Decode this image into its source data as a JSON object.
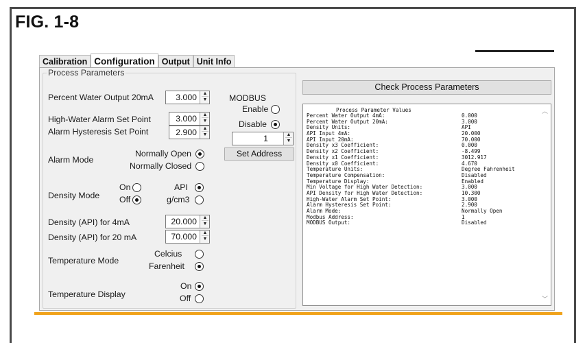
{
  "figure_title": "FIG. 1-8",
  "tabs": [
    "Calibration",
    "Configuration",
    "Output",
    "Unit Info"
  ],
  "process_parameters_title": "Process Parameters",
  "fields": {
    "percent_water_20ma": {
      "label": "Percent Water Output 20mA",
      "value": "3.000"
    },
    "high_water_alarm": {
      "label": "High-Water Alarm Set Point",
      "value": "3.000"
    },
    "alarm_hysteresis": {
      "label": "Alarm Hysteresis Set Point",
      "value": "2.900"
    },
    "density_4ma": {
      "label": "Density (API) for 4mA",
      "value": "20.000"
    },
    "density_20ma": {
      "label": "Density (API) for 20 mA",
      "value": "70.000"
    }
  },
  "alarm_mode": {
    "label": "Alarm Mode",
    "options": [
      "Normally Open",
      "Normally Closed"
    ],
    "selected": "Normally Open"
  },
  "density_mode": {
    "label": "Density Mode",
    "on_label": "On",
    "off_label": "Off",
    "on_off_selected": "Off",
    "api_label": "API",
    "gcm3_label": "g/cm3",
    "unit_selected": "API"
  },
  "temperature_mode": {
    "label": "Temperature Mode",
    "options": [
      "Celcius",
      "Farenheit"
    ],
    "selected": "Farenheit"
  },
  "temperature_display": {
    "label": "Temperature Display",
    "options": [
      "On",
      "Off"
    ],
    "selected": "On"
  },
  "modbus": {
    "title": "MODBUS",
    "enable_label": "Enable",
    "disable_label": "Disable",
    "selected": "Disable",
    "address": "1",
    "set_address_label": "Set Address"
  },
  "check_button_label": "Check Process Parameters",
  "values_box": {
    "header": "Process Parameter Values",
    "rows": [
      {
        "k": "Percent Water Output 4mA:",
        "v": "0.000"
      },
      {
        "k": "Percent Water Output 20mA:",
        "v": "3.000"
      },
      {
        "k": "Density Units:",
        "v": "API"
      },
      {
        "k": "API Input 4mA:",
        "v": "20.000"
      },
      {
        "k": "API Input 20mA:",
        "v": "70.000"
      },
      {
        "k": "Density x3 Coefficient:",
        "v": "0.000"
      },
      {
        "k": "Density x2 Coefficient:",
        "v": "-8.499"
      },
      {
        "k": "Density x1 Coefficient:",
        "v": "3012.917"
      },
      {
        "k": "Density x0 Coefficient:",
        "v": "4.670"
      },
      {
        "k": "Temperature Units:",
        "v": "Degree Fahrenheit"
      },
      {
        "k": "Temperature Compensation:",
        "v": "Disabled"
      },
      {
        "k": "Temperature Display:",
        "v": "Enabled"
      },
      {
        "k": "Min Voltage for High Water Detection:",
        "v": "3.000"
      },
      {
        "k": "API Density for High Water Detection:",
        "v": "10.300"
      },
      {
        "k": "High-Water Alarm Set Point:",
        "v": "3.000"
      },
      {
        "k": "Alarm Hysteresis Set Point:",
        "v": "2.900"
      },
      {
        "k": "Alarm Mode:",
        "v": "Normally Open"
      },
      {
        "k": "Modbus Address:",
        "v": "1"
      },
      {
        "k": "MODBUS Output:",
        "v": "Disabled"
      }
    ]
  },
  "colors": {
    "accent_bar": "#f0a21a",
    "panel_bg": "#f0f0f0",
    "frame": "#4a4a4a"
  }
}
